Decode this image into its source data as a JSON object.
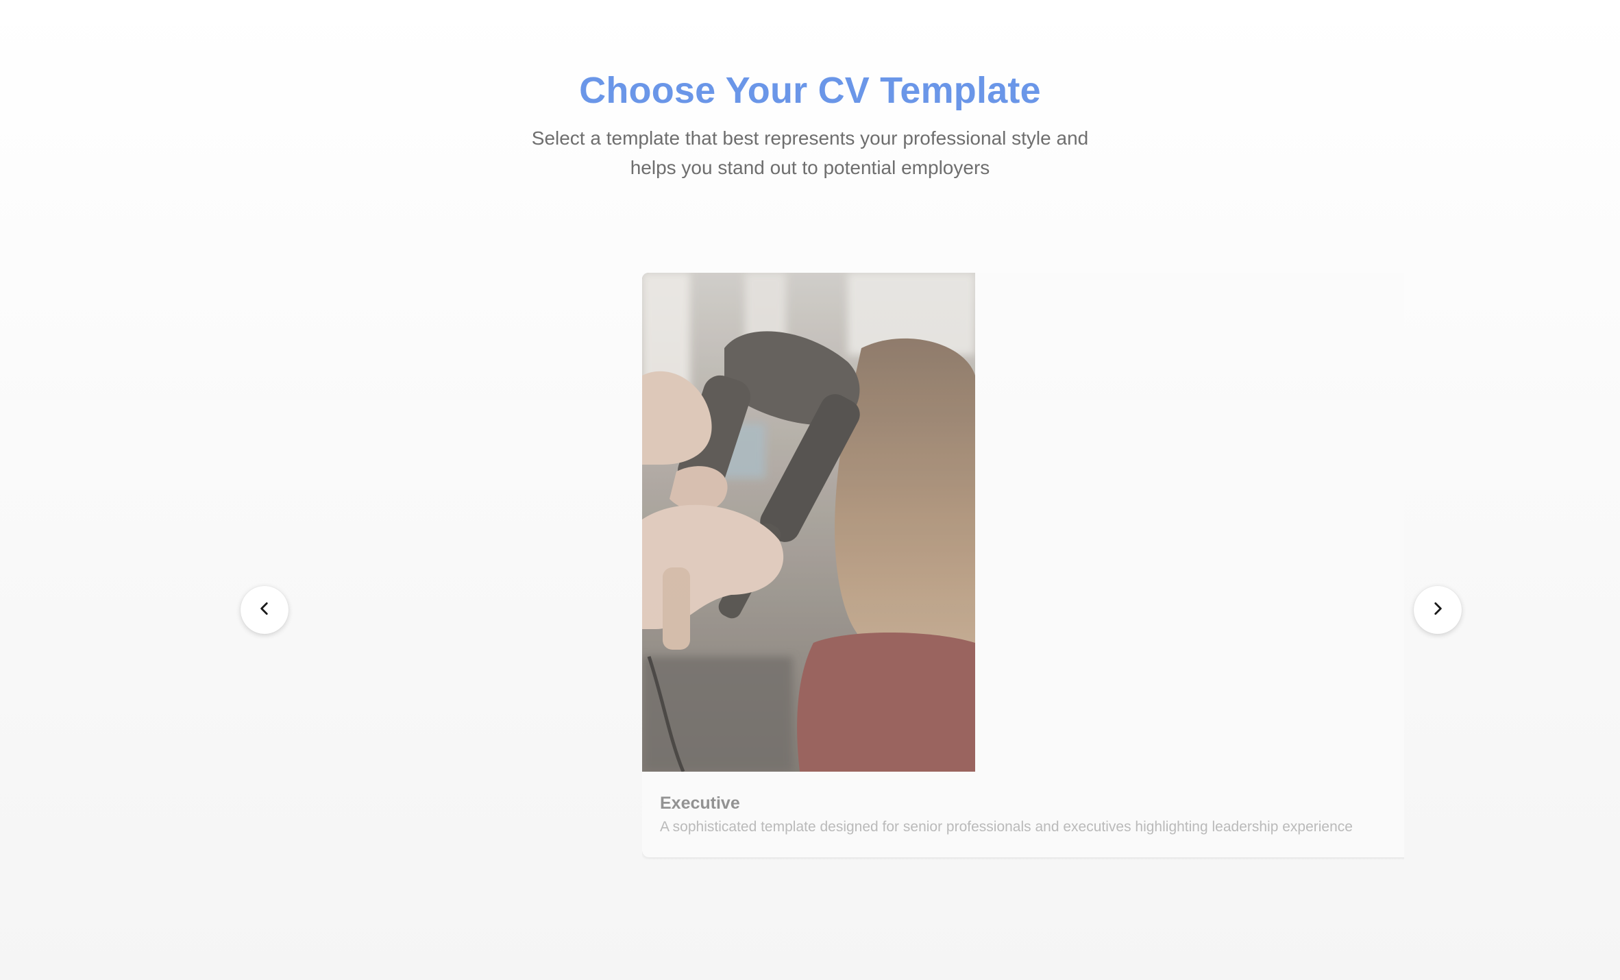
{
  "header": {
    "title": "Choose Your CV Template",
    "subtitle": "Select a template that best represents your professional style and helps you stand out to potential employers"
  },
  "carousel": {
    "prev_icon": "chevron-left-icon",
    "next_icon": "chevron-right-icon",
    "templates": [
      {
        "name": "Executive",
        "description": "A sophisticated template designed for senior professionals and executives highlighting leadership experience",
        "image": "hair-salon-blow-dry-photo"
      }
    ]
  },
  "colors": {
    "accent": "#6a96e8",
    "subtitle_text": "#6e6e6e",
    "card_title_text": "#8a8a8a",
    "card_desc_text": "#b5b5b5"
  }
}
